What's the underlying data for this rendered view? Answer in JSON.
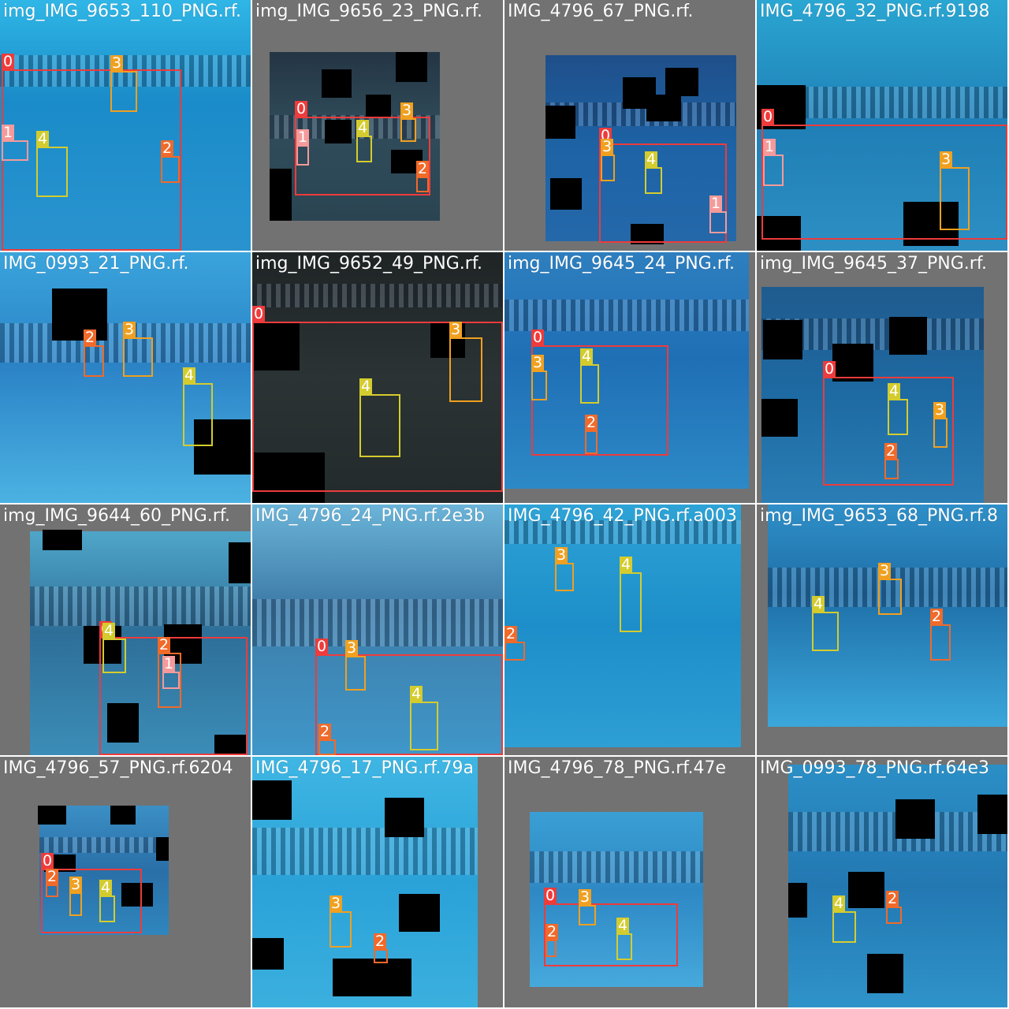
{
  "class_colors": {
    "0": "#ee3b3b",
    "1": "#f59a9a",
    "2": "#f06a2a",
    "3": "#f0a020",
    "4": "#d4cc2e"
  },
  "tiles": [
    {
      "filename": "img_IMG_9653_110_PNG.rf.",
      "photo": {
        "bg": "linear-gradient(180deg,#2fb6e6 0%,#1a8cc9 40%,#2a93cf 100%)"
      },
      "masks": [],
      "boxes": [
        {
          "cls": "0",
          "label": "0"
        },
        {
          "cls": "3",
          "label": "3"
        },
        {
          "cls": "1",
          "label": "1"
        },
        {
          "cls": "4",
          "label": "4"
        },
        {
          "cls": "2",
          "label": "2"
        }
      ]
    },
    {
      "filename": "img_IMG_9656_23_PNG.rf.",
      "photo": {
        "bg": "linear-gradient(180deg,#243544 0%,#304c5a 45%,#2a4452 100%)"
      },
      "masks": [
        {},
        {},
        {},
        {},
        {},
        {}
      ],
      "boxes": [
        {
          "cls": "0",
          "label": "0"
        },
        {
          "cls": "3",
          "label": "3"
        },
        {
          "cls": "4",
          "label": "4"
        },
        {
          "cls": "1",
          "label": "1"
        },
        {
          "cls": "2",
          "label": "2"
        }
      ]
    },
    {
      "filename": "IMG_4796_67_PNG.rf.",
      "photo": {
        "bg": "linear-gradient(180deg,#1f4f8a 0%,#1d63a5 50%,#2468aa 100%)"
      },
      "masks": [
        {},
        {},
        {},
        {},
        {},
        {},
        {}
      ],
      "boxes": [
        {
          "cls": "0",
          "label": "0"
        },
        {
          "cls": "3",
          "label": "3"
        },
        {
          "cls": "4",
          "label": "4"
        },
        {
          "cls": "1",
          "label": "1"
        }
      ]
    },
    {
      "filename": "IMG_4796_32_PNG.rf.9198",
      "photo": {
        "bg": "linear-gradient(180deg,#2aa6d2 0%,#1f7fb6 50%,#2d8fc3 100%)"
      },
      "masks": [
        {},
        {},
        {}
      ],
      "boxes": [
        {
          "cls": "0",
          "label": "0"
        },
        {
          "cls": "1",
          "label": "1"
        },
        {
          "cls": "3",
          "label": "3"
        }
      ]
    },
    {
      "filename": "IMG_0993_21_PNG.rf.",
      "photo": {
        "bg": "linear-gradient(180deg,#3aa4dc 0%,#2b83c6 45%,#4bb2e2 100%)"
      },
      "masks": [
        {},
        {}
      ],
      "boxes": [
        {
          "cls": "2",
          "label": "2"
        },
        {
          "cls": "3",
          "label": "3"
        },
        {
          "cls": "4",
          "label": "4"
        }
      ]
    },
    {
      "filename": "img_IMG_9652_49_PNG.rf.",
      "photo": {
        "bg": "linear-gradient(180deg,#1f2425 0%,#2b3334 50%,#232a2b 100%)"
      },
      "masks": [
        {},
        {},
        {}
      ],
      "boxes": [
        {
          "cls": "0",
          "label": "0"
        },
        {
          "cls": "3",
          "label": "3"
        },
        {
          "cls": "4",
          "label": "4"
        }
      ]
    },
    {
      "filename": "img_IMG_9645_24_PNG.rf.",
      "photo": {
        "bg": "linear-gradient(180deg,#2e7fbf 0%,#1f6fb5 45%,#2d89c6 100%)"
      },
      "masks": [],
      "boxes": [
        {
          "cls": "0",
          "label": "0"
        },
        {
          "cls": "3",
          "label": "3"
        },
        {
          "cls": "4",
          "label": "4"
        },
        {
          "cls": "2",
          "label": "2"
        }
      ]
    },
    {
      "filename": "img_IMG_9645_37_PNG.rf.",
      "photo": {
        "bg": "linear-gradient(180deg,#1f5b8e 0%,#1e6aa3 50%,#2a7eb5 100%)"
      },
      "masks": [
        {},
        {},
        {},
        {}
      ],
      "boxes": [
        {
          "cls": "0",
          "label": "0"
        },
        {
          "cls": "4",
          "label": "4"
        },
        {
          "cls": "3",
          "label": "3"
        },
        {
          "cls": "2",
          "label": "2"
        }
      ]
    },
    {
      "filename": "img_IMG_9644_60_PNG.rf.",
      "photo": {
        "bg": "linear-gradient(180deg,#4fa6c9 0%,#2e6f98 45%,#3b8db8 100%)"
      },
      "masks": [
        {},
        {},
        {},
        {},
        {},
        {}
      ],
      "boxes": [
        {
          "cls": "0",
          "label": "0"
        },
        {
          "cls": "4",
          "label": "4"
        },
        {
          "cls": "2",
          "label": "2"
        },
        {
          "cls": "1",
          "label": "1"
        }
      ]
    },
    {
      "filename": "IMG_4796_24_PNG.rf.2e3b",
      "photo": {
        "bg": "linear-gradient(180deg,#6bb4d8 0%,#3e7ca8 40%,#3f97c9 100%)"
      },
      "masks": [],
      "boxes": [
        {
          "cls": "0",
          "label": "0"
        },
        {
          "cls": "3",
          "label": "3"
        },
        {
          "cls": "4",
          "label": "4"
        },
        {
          "cls": "2",
          "label": "2"
        }
      ]
    },
    {
      "filename": "IMG_4796_42_PNG.rf.a003",
      "photo": {
        "bg": "linear-gradient(180deg,#2da3d6 0%,#1d8ec9 50%,#2e9fd4 100%)"
      },
      "masks": [],
      "boxes": [
        {
          "cls": "3",
          "label": "3"
        },
        {
          "cls": "4",
          "label": "4"
        },
        {
          "cls": "2",
          "label": "2"
        }
      ]
    },
    {
      "filename": "img_IMG_9653_68_PNG.rf.8",
      "photo": {
        "bg": "linear-gradient(180deg,#2f8fc8 0%,#1f6fa8 40%,#3aa7db 100%)"
      },
      "masks": [],
      "boxes": [
        {
          "cls": "3",
          "label": "3"
        },
        {
          "cls": "4",
          "label": "4"
        },
        {
          "cls": "2",
          "label": "2"
        }
      ]
    },
    {
      "filename": "IMG_4796_57_PNG.rf.6204",
      "photo": {
        "bg": "linear-gradient(180deg,#3b8fc5 0%,#2a6fa8 50%,#2f86bd 100%)"
      },
      "masks": [
        {},
        {},
        {},
        {},
        {}
      ],
      "boxes": [
        {
          "cls": "0",
          "label": "0"
        },
        {
          "cls": "2",
          "label": "2"
        },
        {
          "cls": "3",
          "label": "3"
        },
        {
          "cls": "4",
          "label": "4"
        }
      ]
    },
    {
      "filename": "IMG_4796_17_PNG.rf.79a",
      "photo": {
        "bg": "linear-gradient(180deg,#3fb6e3 0%,#2aa2d8 50%,#3bb0df 100%)"
      },
      "masks": [
        {},
        {},
        {},
        {},
        {}
      ],
      "boxes": [
        {
          "cls": "3",
          "label": "3"
        },
        {
          "cls": "2",
          "label": "2"
        }
      ]
    },
    {
      "filename": "IMG_4796_78_PNG.rf.47e",
      "photo": {
        "bg": "linear-gradient(180deg,#3a9fd4 0%,#2e88c4 45%,#46a9dc 100%)"
      },
      "masks": [],
      "boxes": [
        {
          "cls": "0",
          "label": "0"
        },
        {
          "cls": "3",
          "label": "3"
        },
        {
          "cls": "2",
          "label": "2"
        },
        {
          "cls": "4",
          "label": "4"
        }
      ]
    },
    {
      "filename": "IMG_0993_78_PNG.rf.64e3",
      "photo": {
        "bg": "linear-gradient(180deg,#2b8fc6 0%,#2378b2 50%,#2f93c9 100%)"
      },
      "masks": [
        {},
        {},
        {},
        {},
        {}
      ],
      "boxes": [
        {
          "cls": "4",
          "label": "4"
        },
        {
          "cls": "2",
          "label": "2"
        }
      ]
    }
  ]
}
